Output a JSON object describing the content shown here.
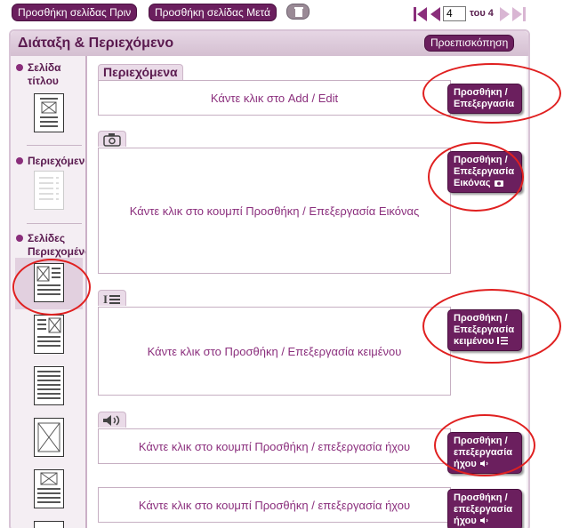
{
  "toolbar": {
    "add_before_label": "Προσθήκη σελίδας Πριν",
    "add_after_label": "Προσθήκη σελίδας Μετά",
    "delete_icon": "trash-icon"
  },
  "pager": {
    "current_page": "4",
    "of_label": "του 4"
  },
  "panel": {
    "title": "Διάταξη & Περιεχόμενο",
    "preview_label": "Προεπισκόπηση"
  },
  "sidebar": {
    "title_page_label": "Σελίδα τίτλου",
    "contents_label": "Περιεχόμενα",
    "content_pages_label": "Σελίδες Περιεχομένου"
  },
  "main": {
    "contents_tab": "Περιεχόμενα",
    "contents_text": "Κάντε κλικ στο Add / Edit",
    "contents_button": "Προσθήκη / Επεξεργασία",
    "image_text": "Κάντε κλικ στο κουμπί Προσθήκη / Επεξεργασία Εικόνας",
    "image_button": "Προσθήκη / Επεξεργασία Εικόνας",
    "text_text": "Κάντε κλικ στο Προσθήκη / Επεξεργασία κειμένου",
    "text_button": "Προσθήκη / Επεξεργασία κειμένου",
    "audio1_text": "Κάντε κλικ στο κουμπί Προσθήκη / επεξεργασία ήχου",
    "audio1_button": "Προσθήκη / επεξεργασία ήχου",
    "audio2_text": "Κάντε κλικ στο κουμπί Προσθήκη / επεξεργασία ήχου",
    "audio2_button": "Προσθήκη / επεξεργασία ήχου"
  },
  "colors": {
    "accent": "#6b1f5e",
    "highlight_ring": "#e02020"
  }
}
